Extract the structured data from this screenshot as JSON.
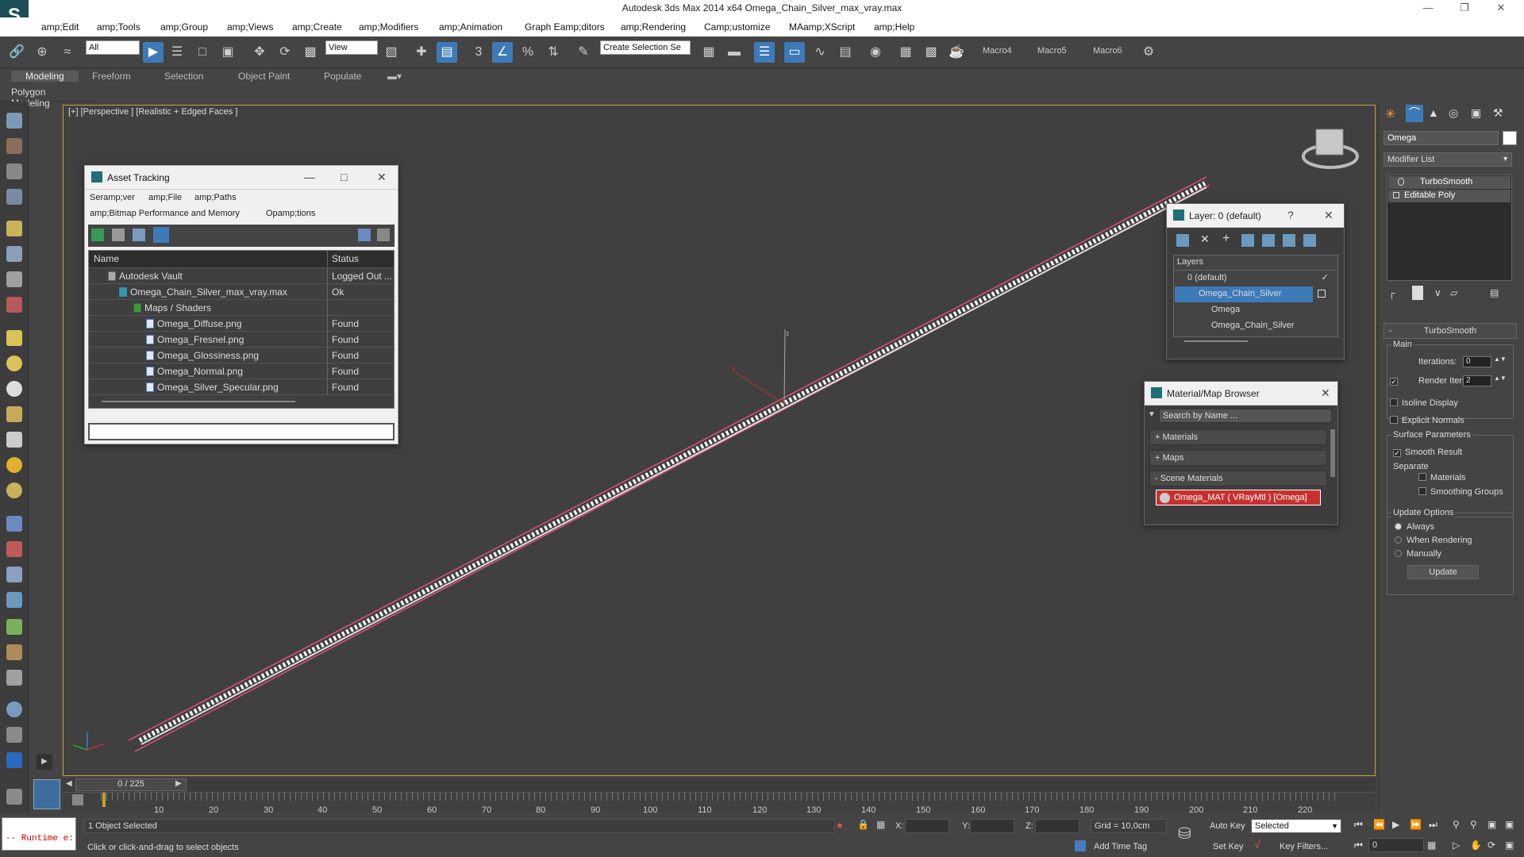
{
  "window": {
    "title": "Autodesk 3ds Max  2014 x64     Omega_Chain_Silver_max_vray.max"
  },
  "menu": [
    "amp;Edit",
    "amp;Tools",
    "amp;Group",
    "amp;Views",
    "amp;Create",
    "amp;Modifiers",
    "amp;Animation",
    "Graph Eamp;ditors",
    "amp;Rendering",
    "Camp;ustomize",
    "MAamp;XScript",
    "amp;Help"
  ],
  "toolbar": {
    "selection_filter": "All",
    "ref_coord": "View",
    "named_selection": "Create Selection Se",
    "macros": [
      "Macro4",
      "Macro5",
      "Macro6"
    ]
  },
  "ribbon": {
    "tabs": [
      "Modeling",
      "Freeform",
      "Selection",
      "Object Paint",
      "Populate"
    ],
    "sub": "Polygon Modeling"
  },
  "viewport": {
    "label": "[+] [Perspective ] [Realistic + Edged Faces ]"
  },
  "asset_tracking": {
    "title": "Asset Tracking",
    "menu1": [
      "Seramp;ver",
      "amp;File",
      "amp;Paths"
    ],
    "menu2": [
      "amp;Bitmap Performance and Memory",
      "Opamp;tions"
    ],
    "col_name": "Name",
    "col_status": "Status",
    "rows": [
      {
        "name": "Autodesk Vault",
        "status": "Logged Out ..."
      },
      {
        "name": "Omega_Chain_Silver_max_vray.max",
        "status": "Ok"
      },
      {
        "name": "Maps / Shaders",
        "status": ""
      },
      {
        "name": "Omega_Diffuse.png",
        "status": "Found"
      },
      {
        "name": "Omega_Fresnel.png",
        "status": "Found"
      },
      {
        "name": "Omega_Glossiness.png",
        "status": "Found"
      },
      {
        "name": "Omega_Normal.png",
        "status": "Found"
      },
      {
        "name": "Omega_Silver_Specular.png",
        "status": "Found"
      }
    ]
  },
  "layer_panel": {
    "title": "Layer: 0 (default)",
    "help": "?",
    "header": "Layers",
    "items": [
      "0 (default)",
      "Omega_Chain_Silver",
      "Omega",
      "Omega_Chain_Silver"
    ]
  },
  "material_browser": {
    "title": "Material/Map Browser",
    "search_placeholder": "Search by Name ...",
    "sections": [
      "+ Materials",
      "+ Maps",
      "- Scene Materials"
    ],
    "material": "Omega_MAT ( VRayMtl ) [Omega]"
  },
  "command_panel": {
    "object_name": "Omega",
    "modifier_list": "Modifier List",
    "stack": [
      "TurboSmooth",
      "Editable Poly"
    ],
    "rollout_title": "TurboSmooth",
    "main_label": "Main",
    "iterations_label": "Iterations:",
    "iterations_value": "0",
    "render_iters_label": "Render Iters:",
    "render_iters_value": "2",
    "isoline": "Isoline Display",
    "explicit_normals": "Explicit Normals",
    "surface_params": "Surface Parameters",
    "smooth_result": "Smooth Result",
    "separate": "Separate",
    "materials": "Materials",
    "smoothing_groups": "Smoothing Groups",
    "update_options": "Update Options",
    "always": "Always",
    "when_rendering": "When Rendering",
    "manually": "Manually",
    "update_button": "Update"
  },
  "timeline": {
    "frame": "0 / 225",
    "ticks": [
      "10",
      "20",
      "30",
      "40",
      "50",
      "60",
      "70",
      "80",
      "90",
      "100",
      "110",
      "120",
      "130",
      "140",
      "150",
      "160",
      "170",
      "180",
      "190",
      "200",
      "210",
      "220"
    ]
  },
  "status": {
    "script": "-- Runtime e:",
    "selected": "1 Object Selected",
    "prompt": "Click or click-and-drag to select objects",
    "x_label": "X:",
    "y_label": "Y:",
    "z_label": "Z:",
    "grid": "Grid = 10,0cm",
    "add_time_tag": "Add Time Tag",
    "auto_key": "Auto Key",
    "set_key": "Set Key",
    "key_mode": "Selected",
    "key_filters": "Key Filters...",
    "frame_value": "0"
  },
  "colors": {
    "selection_blue": "#3d7ab8",
    "viewport_border": "#c7a33d",
    "chain_highlight": "#e0507a"
  }
}
